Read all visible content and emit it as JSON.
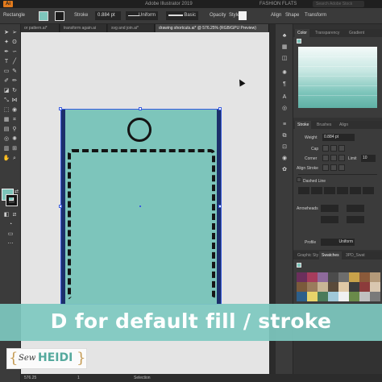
{
  "menubar": {
    "app_logo": "Ai",
    "app_title": "Adobe Illustrator 2019",
    "workspace": "FASHION FLATS",
    "search_placeholder": "Search Adobe Stock"
  },
  "controlbar": {
    "selection": "Rectangle",
    "stroke_label": "Stroke",
    "stroke_weight": "0.884 pt",
    "profile": "Uniform",
    "brush": "Basic",
    "opacity_label": "Opacity",
    "style_label": "Style",
    "align_label": "Align",
    "shape_label": "Shape",
    "transform_label": "Transform"
  },
  "tabs": [
    "or pattern.ai*",
    "transform again.ai",
    "svg and join.ai*",
    "drawing shortcuts.ai* @ 576.25% (RGB/GPU Preview)"
  ],
  "panels": {
    "color_tabs": [
      "Color",
      "Transparency",
      "Gradient"
    ],
    "stroke_tabs": [
      "Stroke",
      "Brushes",
      "Align"
    ],
    "stroke": {
      "weight_label": "Weight",
      "weight_value": "0.884 pt",
      "cap_label": "Cap",
      "corner_label": "Corner",
      "limit_label": "Limit",
      "limit_value": "10",
      "align_label": "Align Stroke",
      "dashed_label": "Dashed Line",
      "arrowheads_label": "Arrowheads",
      "profile_label": "Profile",
      "profile_value": "Uniform"
    },
    "swatch_tabs": [
      "Graphic Sty",
      "Swatches",
      "3PD_Swat"
    ]
  },
  "banner": {
    "text": "D for default fill / stroke"
  },
  "logo": {
    "sew": "Sew",
    "heidi": "HEIDI"
  },
  "statusbar": {
    "zoom": "576.25",
    "artboard": "1",
    "tool": "Selection"
  },
  "colors": {
    "fill": "#7dc5bb",
    "stroke": "#141414",
    "canvas": "#e4e4e4",
    "banner": "#7ec9c0"
  }
}
